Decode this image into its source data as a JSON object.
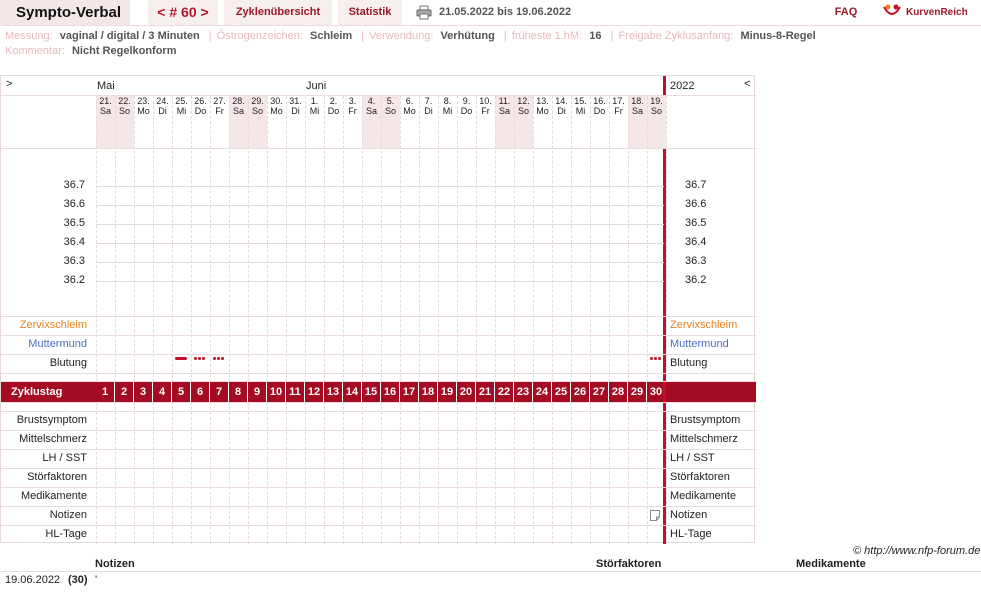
{
  "header": {
    "app_title": "Sympto-Verbal",
    "cycle_nav": "< # 60 >",
    "tab_overview": "Zyklenübersicht",
    "tab_stats": "Statistik",
    "date_range": "21.05.2022 bis 19.06.2022",
    "faq": "FAQ",
    "brand": "KurvenReich"
  },
  "info": {
    "messung_label": "Messung:",
    "messung_value": "vaginal / digital / 3 Minuten",
    "oestrogen_label": "Östrogenzeichen:",
    "oestrogen_value": "Schleim",
    "verwendung_label": "Verwendung:",
    "verwendung_value": "Verhütung",
    "fruehe_label": "früheste 1.hM:",
    "fruehe_value": "16",
    "freigabe_label": "Freigabe Zyklusanfang:",
    "freigabe_value": "Minus-8-Regel",
    "kommentar_label": "Kommentar:",
    "kommentar_value": "Nicht Regelkonform"
  },
  "chart": {
    "nav_left": ">",
    "nav_right": "<",
    "month_1": "Mai",
    "month_2": "Juni",
    "year": "2022",
    "days": [
      {
        "d": "21.",
        "w": "Sa",
        "we": true
      },
      {
        "d": "22.",
        "w": "So",
        "we": true
      },
      {
        "d": "23.",
        "w": "Mo",
        "we": false
      },
      {
        "d": "24.",
        "w": "Di",
        "we": false
      },
      {
        "d": "25.",
        "w": "Mi",
        "we": false
      },
      {
        "d": "26.",
        "w": "Do",
        "we": false
      },
      {
        "d": "27.",
        "w": "Fr",
        "we": false
      },
      {
        "d": "28.",
        "w": "Sa",
        "we": true
      },
      {
        "d": "29.",
        "w": "So",
        "we": true
      },
      {
        "d": "30.",
        "w": "Mo",
        "we": false
      },
      {
        "d": "31.",
        "w": "Di",
        "we": false
      },
      {
        "d": "1.",
        "w": "Mi",
        "we": false
      },
      {
        "d": "2.",
        "w": "Do",
        "we": false
      },
      {
        "d": "3.",
        "w": "Fr",
        "we": false
      },
      {
        "d": "4.",
        "w": "Sa",
        "we": true
      },
      {
        "d": "5.",
        "w": "So",
        "we": true
      },
      {
        "d": "6.",
        "w": "Mo",
        "we": false
      },
      {
        "d": "7.",
        "w": "Di",
        "we": false
      },
      {
        "d": "8.",
        "w": "Mi",
        "we": false
      },
      {
        "d": "9.",
        "w": "Do",
        "we": false
      },
      {
        "d": "10.",
        "w": "Fr",
        "we": false
      },
      {
        "d": "11.",
        "w": "Sa",
        "we": true
      },
      {
        "d": "12.",
        "w": "So",
        "we": true
      },
      {
        "d": "13.",
        "w": "Mo",
        "we": false
      },
      {
        "d": "14.",
        "w": "Di",
        "we": false
      },
      {
        "d": "15.",
        "w": "Mi",
        "we": false
      },
      {
        "d": "16.",
        "w": "Do",
        "we": false
      },
      {
        "d": "17.",
        "w": "Fr",
        "we": false
      },
      {
        "d": "18.",
        "w": "Sa",
        "we": true
      },
      {
        "d": "19.",
        "w": "So",
        "we": true
      }
    ],
    "temperatures": [
      "36.7",
      "36.6",
      "36.5",
      "36.4",
      "36.3",
      "36.2"
    ],
    "rows_top": [
      "Zervixschleim",
      "Muttermund",
      "Blutung"
    ],
    "rows_top_colors": [
      "#e8821e",
      "#4a6fc8",
      "#222222"
    ],
    "bleeding": [
      {
        "day": 5,
        "type": "strong"
      },
      {
        "day": 6,
        "type": "dots"
      },
      {
        "day": 7,
        "type": "dots"
      },
      {
        "day": 30,
        "type": "dots"
      }
    ],
    "cycle_label": "Zyklustag",
    "cycle_days": [
      "1",
      "2",
      "3",
      "4",
      "5",
      "6",
      "7",
      "8",
      "9",
      "10",
      "11",
      "12",
      "13",
      "14",
      "15",
      "16",
      "17",
      "18",
      "19",
      "20",
      "21",
      "22",
      "23",
      "24",
      "25",
      "26",
      "27",
      "28",
      "29",
      "30"
    ],
    "rows_bottom": [
      "Brustsymptom",
      "Mittelschmerz",
      "LH / SST",
      "Störfaktoren",
      "Medikamente",
      "Notizen",
      "HL-Tage"
    ],
    "note_day": 30
  },
  "footer": {
    "copyright": "© http://www.nfp-forum.de",
    "col_notizen": "Notizen",
    "col_stoer": "Störfaktoren",
    "col_medi": "Medikamente",
    "row_date": "19.06.2022",
    "row_day": "(30)",
    "row_note": "'"
  }
}
